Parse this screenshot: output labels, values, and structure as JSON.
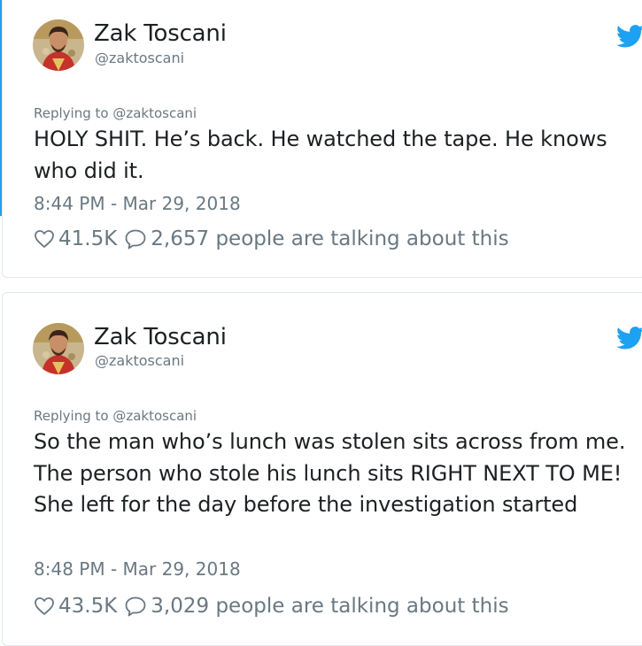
{
  "tweets": [
    {
      "author": {
        "name": "Zak Toscani",
        "handle": "@zaktoscani"
      },
      "replying_to": "Replying to @zaktoscani",
      "text": "HOLY SHIT. He’s back. He watched the tape. He knows who did it.",
      "timestamp": "8:44 PM - Mar 29, 2018",
      "likes": "41.5K",
      "talking": "2,657 people are talking about this"
    },
    {
      "author": {
        "name": "Zak Toscani",
        "handle": "@zaktoscani"
      },
      "replying_to": "Replying to @zaktoscani",
      "text": "So the man who’s lunch was stolen sits across from me. The person who  stole his lunch sits RIGHT NEXT TO ME! She left for the day before the investigation started",
      "timestamp": "8:48 PM - Mar 29, 2018",
      "likes": "43.5K",
      "talking": "3,029 people are talking about this"
    }
  ],
  "icons": {
    "brand": "twitter-bird-icon",
    "like": "heart-icon",
    "reply": "speech-bubble-icon"
  },
  "colors": {
    "twitter_blue": "#1da1f2",
    "text": "#1c2022",
    "muted": "#697882",
    "border": "#e1e8ed"
  }
}
